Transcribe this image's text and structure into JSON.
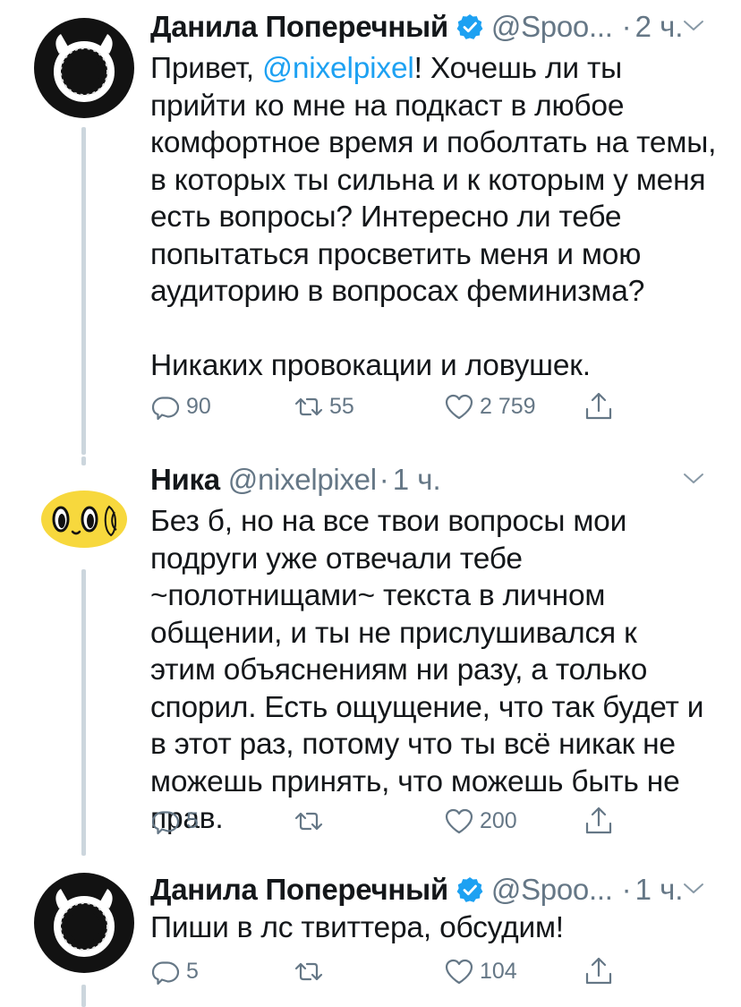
{
  "tweets": [
    {
      "author": "Данила Поперечный",
      "handle": "@Spoo...",
      "sep": "·",
      "time": "2 ч.",
      "text_before": "Привет, ",
      "mention": "@nixelpixel",
      "text_after": "! Хочешь ли ты прийти ко мне на подкаст в любое комфортное время и поболтать на темы, в которых ты сильна и к которым у меня есть вопросы? Интересно ли тебе попытаться просветить меня и мою аудиторию в вопросах феминизма?",
      "text_p2": "Никаких провокации и ловушек.",
      "replies": "90",
      "retweets": "55",
      "likes": "2 759"
    },
    {
      "author": "Ника",
      "handle": "@nixelpixel",
      "sep": "·",
      "time": "1 ч.",
      "text": "Без б, но на все твои вопросы мои подруги уже отвечали тебе ~полотнищами~ текста в личном общении, и ты не прислушивался к этим объяснениям ни разу, а только спорил. Есть ощущение, что так будет и в этот раз, потому что ты всё никак не можешь принять, что можешь быть не прав.",
      "replies": "5",
      "retweets": "",
      "likes": "200"
    },
    {
      "author": "Данила Поперечный",
      "handle": "@Spoo...",
      "sep": "·",
      "time": "1 ч.",
      "text": "Пиши в лс твиттера, обсудим!",
      "replies": "5",
      "retweets": "",
      "likes": "104"
    }
  ],
  "icons": {
    "verified": "verified-badge-icon",
    "chevron": "chevron-down-icon",
    "reply": "reply-icon",
    "retweet": "retweet-icon",
    "like": "heart-icon",
    "share": "share-icon"
  },
  "colors": {
    "accent": "#1da1f2",
    "muted": "#657786",
    "thread_line": "#ccd6dd",
    "nika_avatar": "#f7d83d"
  }
}
